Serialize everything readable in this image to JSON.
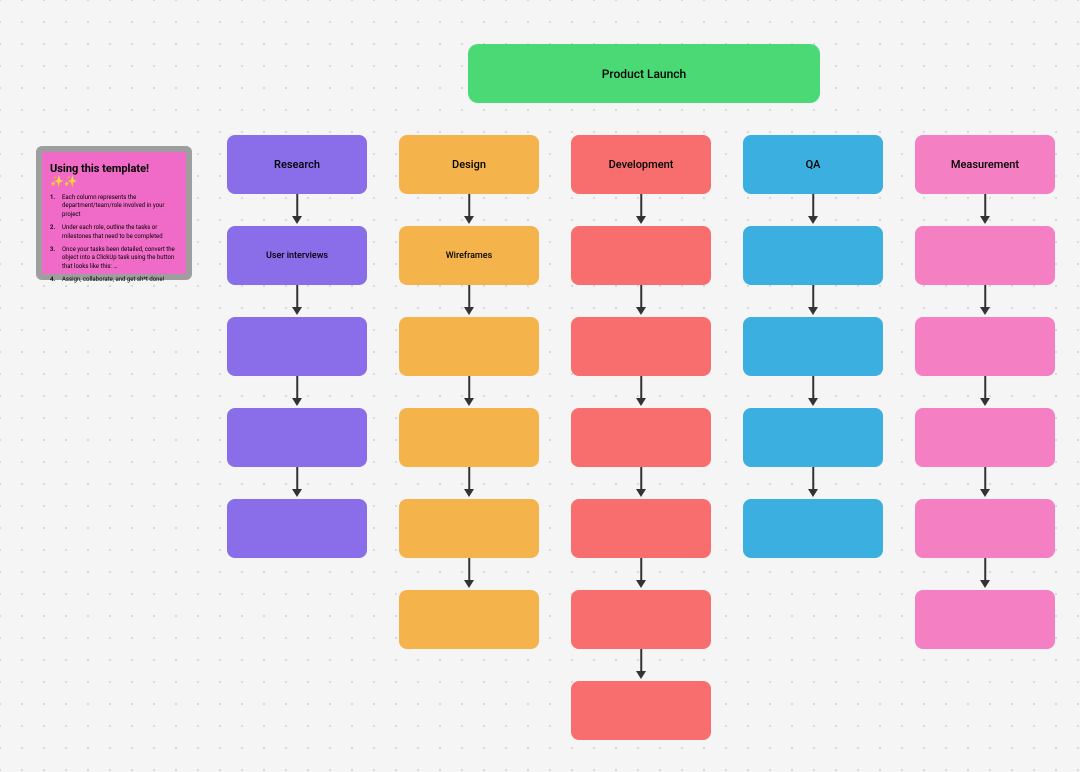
{
  "title": "Product Launch",
  "sticky": {
    "heading": "Using this template! ✨✨",
    "items": [
      "Each column represents the department/team/role involved in your project",
      "Under each role, outline the tasks or milestones that need to be completed",
      "Once your tasks been detailed, convert the object into a ClickUp task using the button that looks like this: …",
      "Assign, collaborate, and get sh*t done!"
    ]
  },
  "columns": [
    {
      "header": "Research",
      "color": "purple",
      "cells": [
        "User interviews",
        "",
        "",
        ""
      ]
    },
    {
      "header": "Design",
      "color": "orange",
      "cells": [
        "Wireframes",
        "",
        "",
        "",
        ""
      ]
    },
    {
      "header": "Development",
      "color": "coral",
      "cells": [
        "",
        "",
        "",
        "",
        "",
        ""
      ]
    },
    {
      "header": "QA",
      "color": "blue",
      "cells": [
        "",
        "",
        "",
        ""
      ]
    },
    {
      "header": "Measurement",
      "color": "pink",
      "cells": [
        "",
        "",
        "",
        "",
        ""
      ]
    }
  ]
}
